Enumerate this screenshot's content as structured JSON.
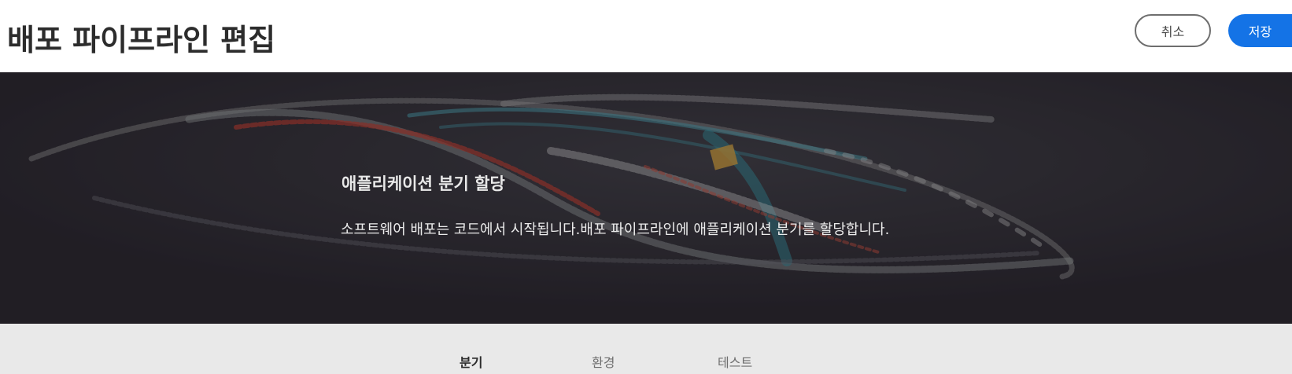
{
  "header": {
    "title": "배포 파이프라인 편집",
    "cancel_label": "취소",
    "save_label": "저장"
  },
  "hero": {
    "title": "애플리케이션 분기 할당",
    "description": "소프트웨어 배포는 코드에서 시작됩니다.배포 파이프라인에 애플리케이션 분기를 할당합니다."
  },
  "tabs": [
    {
      "label": "분기",
      "active": true
    },
    {
      "label": "환경",
      "active": false
    },
    {
      "label": "테스트",
      "active": false
    }
  ],
  "colors": {
    "accent": "#1473e6",
    "hero_background": "#2a2830",
    "tabbar_background": "#e9e9e9"
  }
}
